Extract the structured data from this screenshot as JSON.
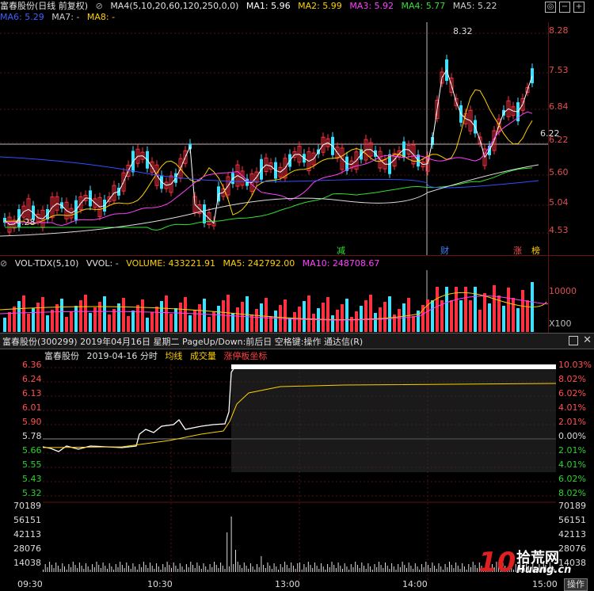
{
  "top_panel": {
    "title": "富春股份(日线 前复权)",
    "indicator": "MA4(5,10,20,60,120,250,0,0)",
    "ma": [
      {
        "label": "MA1: 5.96",
        "color": "#ffffff"
      },
      {
        "label": "MA2: 5.99",
        "color": "#ffd000"
      },
      {
        "label": "MA3: 5.92",
        "color": "#ff40ff"
      },
      {
        "label": "MA4: 5.77",
        "color": "#30e030"
      },
      {
        "label": "MA5: 5.22",
        "color": "#cccccc"
      }
    ],
    "ma_row2": [
      {
        "label": "MA6: 5.29",
        "color": "#4060ff"
      },
      {
        "label": "MA7: -",
        "color": "#cccccc"
      },
      {
        "label": "MA8: -",
        "color": "#ffd000"
      }
    ],
    "y_ticks": [
      "8.28",
      "7.53",
      "6.84",
      "6.22",
      "5.60",
      "5.04",
      "4.53"
    ],
    "annotations": {
      "high": "8.32",
      "low": "4.28",
      "last": "6.22"
    },
    "markers": [
      {
        "text": "减",
        "color": "#30e030"
      },
      {
        "text": "财",
        "color": "#4080ff"
      },
      {
        "text": "涨",
        "color": "#ff5050"
      },
      {
        "text": "榜",
        "color": "#ffd000"
      }
    ]
  },
  "vol_panel": {
    "title": "VOL-TDX(5,10)",
    "vvol": "VVOL: -",
    "volume": "VOLUME: 433221.91",
    "ma5": "MA5: 242792.00",
    "ma10": "MA10: 248708.67",
    "tick": "10000",
    "multiplier": "X100"
  },
  "intraday_window": {
    "title": "富春股份(300299) 2019年04月16日 星期二 PageUp/Down:前后日 空格键:操作 通达信(R)",
    "header": {
      "stock": "富春股份",
      "date": "2019-04-16 分时",
      "avg_line": "均线",
      "volume_label": "成交量",
      "limit_label": "涨停板坐标"
    },
    "left_price_ticks": [
      "6.36",
      "6.24",
      "6.13",
      "6.01",
      "5.90",
      "5.78",
      "5.66",
      "5.55",
      "5.43",
      "5.32"
    ],
    "right_pct_ticks": [
      "10.03%",
      "8.02%",
      "6.02%",
      "4.01%",
      "2.01%",
      "0.00%",
      "2.01%",
      "4.01%",
      "6.02%",
      "8.02%"
    ],
    "vol_ticks": [
      "70189",
      "56151",
      "42113",
      "28076",
      "14038"
    ],
    "time_ticks": [
      "09:30",
      "10:30",
      "13:00",
      "14:00",
      "15:00"
    ],
    "bottom_button": "操作",
    "watermark": {
      "brand": "10",
      "site": "拾荒网",
      "url": "Huang.cn"
    }
  }
}
